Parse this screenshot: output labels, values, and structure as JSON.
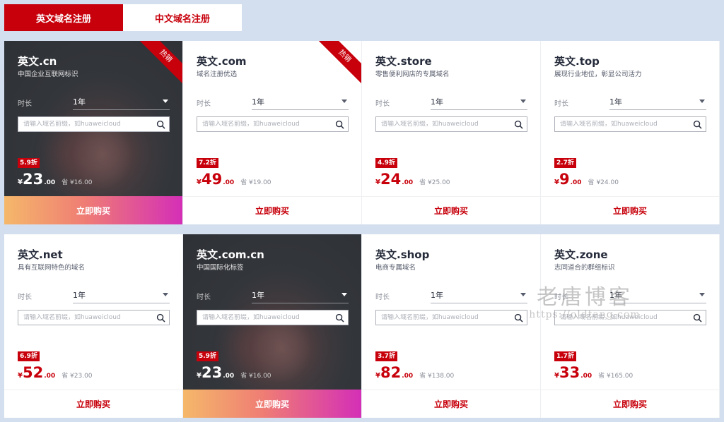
{
  "tabs": [
    {
      "label": "英文域名注册",
      "active": true
    },
    {
      "label": "中文域名注册",
      "active": false
    }
  ],
  "common": {
    "duration_label": "时长",
    "duration_value": "1年",
    "search_placeholder": "请输入域名前缀，如huaweicloud",
    "buy_label": "立即购买",
    "currency": "¥",
    "save_prefix": "省"
  },
  "cards": [
    {
      "title": "英文.cn",
      "subtitle": "中国企业互联网标识",
      "discount": "5.9折",
      "price": "23",
      "cents": ".00",
      "save": "¥16.00",
      "hot": "热销",
      "dark": true
    },
    {
      "title": "英文.com",
      "subtitle": "域名注册优选",
      "discount": "7.2折",
      "price": "49",
      "cents": ".00",
      "save": "¥19.00",
      "hot": "热销",
      "dark": false
    },
    {
      "title": "英文.store",
      "subtitle": "零售便利网店的专属域名",
      "discount": "4.9折",
      "price": "24",
      "cents": ".00",
      "save": "¥25.00",
      "hot": "",
      "dark": false
    },
    {
      "title": "英文.top",
      "subtitle": "展现行业地位，彰显公司活力",
      "discount": "2.7折",
      "price": "9",
      "cents": ".00",
      "save": "¥24.00",
      "hot": "",
      "dark": false
    },
    {
      "title": "英文.net",
      "subtitle": "具有互联网特色的域名",
      "discount": "6.9折",
      "price": "52",
      "cents": ".00",
      "save": "¥23.00",
      "hot": "",
      "dark": false
    },
    {
      "title": "英文.com.cn",
      "subtitle": "中国国际化标签",
      "discount": "5.9折",
      "price": "23",
      "cents": ".00",
      "save": "¥16.00",
      "hot": "",
      "dark": true
    },
    {
      "title": "英文.shop",
      "subtitle": "电商专属域名",
      "discount": "3.7折",
      "price": "82",
      "cents": ".00",
      "save": "¥138.00",
      "hot": "",
      "dark": false
    },
    {
      "title": "英文.zone",
      "subtitle": "志同道合的群组标识",
      "discount": "1.7折",
      "price": "33",
      "cents": ".00",
      "save": "¥165.00",
      "hot": "",
      "dark": false
    }
  ],
  "watermark": {
    "main": "老唐博客",
    "url": "https://oldtang.com"
  },
  "colors": {
    "accent": "#c7000b",
    "page_bg": "#d3deee"
  }
}
